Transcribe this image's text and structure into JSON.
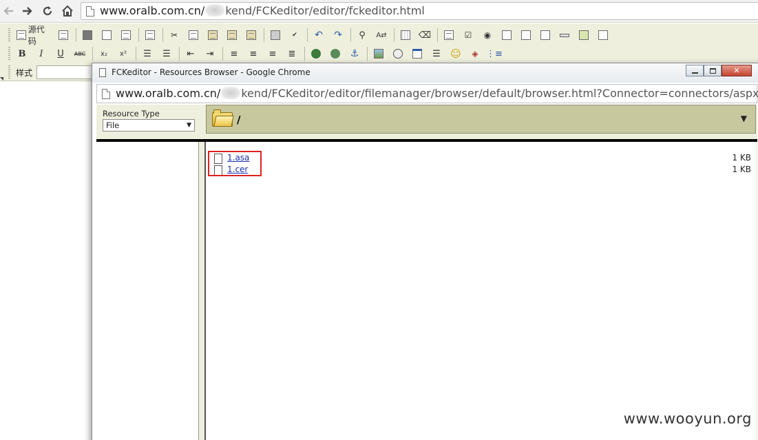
{
  "browser": {
    "url_host": "www.oralb.com.cn/",
    "url_path": "kend/FCKeditor/editor/fckeditor.html"
  },
  "editor": {
    "source_label": "源代码",
    "bold": "B",
    "italic": "I",
    "underline": "U",
    "strike": "ABC",
    "subscript": "x₂",
    "superscript": "x²",
    "style_label": "样式"
  },
  "popup": {
    "title": "FCKeditor - Resources Browser - Google Chrome",
    "url_host": "www.oralb.com.cn/",
    "url_path": "kend/FCKeditor/editor/filemanager/browser/default/browser.html?Connector=connectors/aspx/cc",
    "resource_type_label": "Resource Type",
    "resource_type_value": "File",
    "folder_path": "/",
    "files": [
      {
        "name": "1.asa",
        "size": "1 KB"
      },
      {
        "name": "1.cer",
        "size": "1 KB"
      }
    ]
  },
  "watermark": "www.wooyun.org",
  "colors": {
    "toolbar_bg": "#efefde",
    "folderbar_bg": "#c8c89f",
    "highlight_border": "#e02020",
    "link": "#1a2fb0"
  }
}
